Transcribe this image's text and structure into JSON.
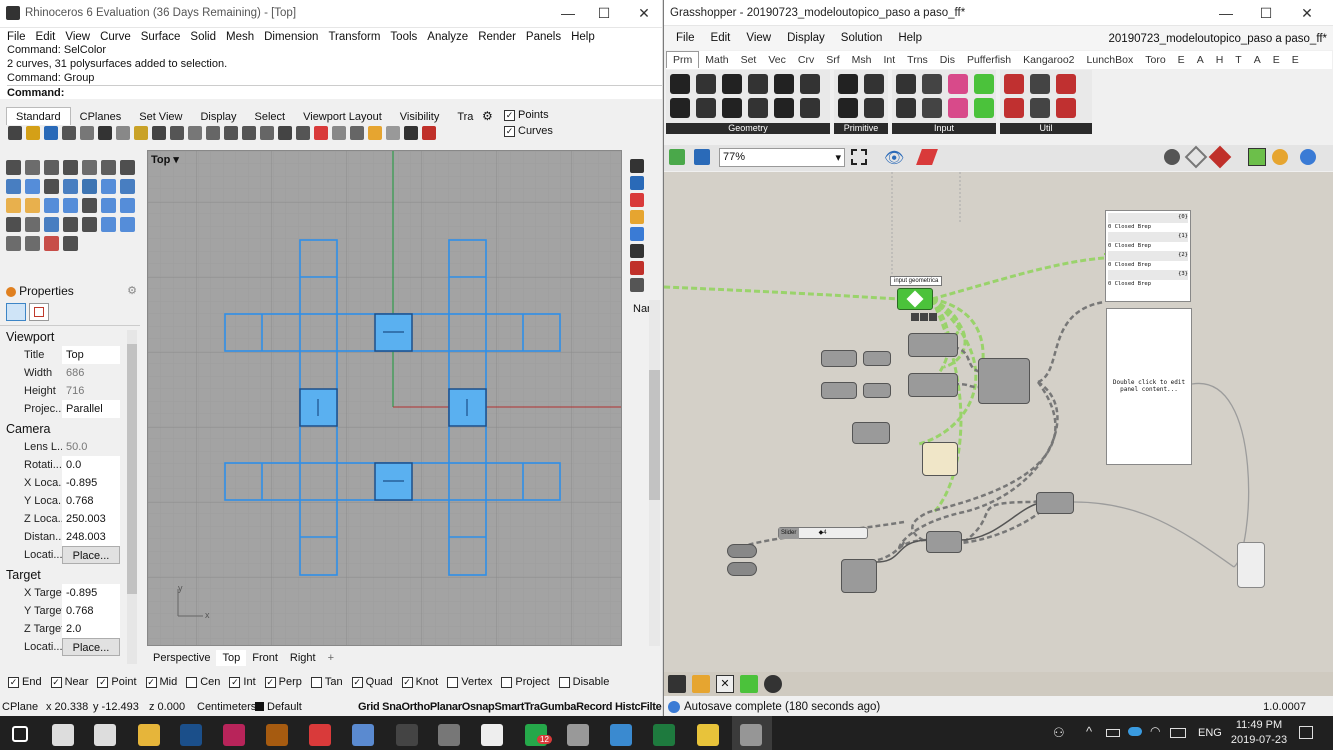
{
  "rhino": {
    "title": "Rhinoceros 6 Evaluation (36 Days Remaining) - [Top]",
    "menu": [
      "File",
      "Edit",
      "View",
      "Curve",
      "Surface",
      "Solid",
      "Mesh",
      "Dimension",
      "Transform",
      "Tools",
      "Analyze",
      "Render",
      "Panels",
      "Help"
    ],
    "history": [
      "Command: SelColor",
      "2 curves, 31 polysurfaces added to selection.",
      "Command: Group"
    ],
    "command_label": "Command:",
    "toolbar_tabs": [
      "Standard",
      "CPlanes",
      "Set View",
      "Display",
      "Select",
      "Viewport Layout",
      "Visibility",
      "Tra"
    ],
    "filters": [
      "Points",
      "Curves"
    ],
    "viewport_title": "Top",
    "view_tabs": [
      "Perspective",
      "Top",
      "Front",
      "Right"
    ],
    "properties_title": "Properties",
    "viewport_section": "Viewport",
    "viewport_props": [
      {
        "label": "Title",
        "value": "Top"
      },
      {
        "label": "Width",
        "value": "686"
      },
      {
        "label": "Height",
        "value": "716"
      },
      {
        "label": "Projec...",
        "value": "Parallel"
      }
    ],
    "camera_section": "Camera",
    "camera_props": [
      {
        "label": "Lens L...",
        "value": "50.0"
      },
      {
        "label": "Rotati...",
        "value": "0.0"
      },
      {
        "label": "X Loca...",
        "value": "-0.895"
      },
      {
        "label": "Y Loca...",
        "value": "0.768"
      },
      {
        "label": "Z Loca...",
        "value": "250.003"
      },
      {
        "label": "Distan...",
        "value": "248.003"
      },
      {
        "label": "Locati...",
        "value": "Place..."
      }
    ],
    "target_section": "Target",
    "target_props": [
      {
        "label": "X Target",
        "value": "-0.895"
      },
      {
        "label": "Y Target",
        "value": "0.768"
      },
      {
        "label": "Z Target",
        "value": "2.0"
      },
      {
        "label": "Locati...",
        "value": "Place..."
      }
    ],
    "side_label": "Nar",
    "osnaps": [
      {
        "label": "End",
        "checked": true
      },
      {
        "label": "Near",
        "checked": true
      },
      {
        "label": "Point",
        "checked": true
      },
      {
        "label": "Mid",
        "checked": true
      },
      {
        "label": "Cen",
        "checked": false
      },
      {
        "label": "Int",
        "checked": true
      },
      {
        "label": "Perp",
        "checked": true
      },
      {
        "label": "Tan",
        "checked": false
      },
      {
        "label": "Quad",
        "checked": true
      },
      {
        "label": "Knot",
        "checked": true
      },
      {
        "label": "Vertex",
        "checked": false
      },
      {
        "label": "Project",
        "checked": false
      },
      {
        "label": "Disable",
        "checked": false
      }
    ],
    "status": {
      "cplane": "CPlane",
      "x": "x 20.338",
      "y": "y -12.493",
      "z": "z 0.000",
      "units": "Centimeters",
      "layer": "Default",
      "toggles": "Grid SnaOrthoPlanarOsnapSmartTraGumbaRecord HistcFilter"
    }
  },
  "grasshopper": {
    "title": "Grasshopper - 20190723_modeloutopico_paso a paso_ff*",
    "doc_title": "20190723_modeloutopico_paso a paso_ff*",
    "menu": [
      "File",
      "Edit",
      "View",
      "Display",
      "Solution",
      "Help"
    ],
    "tabs": [
      "Prm",
      "Math",
      "Set",
      "Vec",
      "Crv",
      "Srf",
      "Msh",
      "Int",
      "Trns",
      "Dis",
      "Pufferfish",
      "Kangaroo2",
      "LunchBox",
      "Toro",
      "E",
      "A",
      "H",
      "T",
      "A",
      "E",
      "E"
    ],
    "groups": [
      "Geometry",
      "Primitive",
      "Input",
      "Util"
    ],
    "zoom": "77%",
    "tooltip": "input geometrica",
    "panel_rows": [
      "{0}",
      "0 Closed Brep",
      "{1}",
      "0 Closed Brep",
      "{2}",
      "0 Closed Brep",
      "{3}",
      "0 Closed Brep"
    ],
    "panel_hint": "Double click to edit panel content...",
    "slider_label": "Slider",
    "slider_value": "◆4",
    "status": "Autosave complete (180 seconds ago)",
    "version": "1.0.0007"
  },
  "taskbar": {
    "time": "11:49 PM",
    "date": "2019-07-23",
    "lang": "ENG",
    "badge": "12"
  },
  "colors": {
    "selection": "#2f8fe8",
    "grid": "#9c9c9c",
    "gh_canvas": "#d4d0c8",
    "accent_green": "#4bc23b"
  }
}
